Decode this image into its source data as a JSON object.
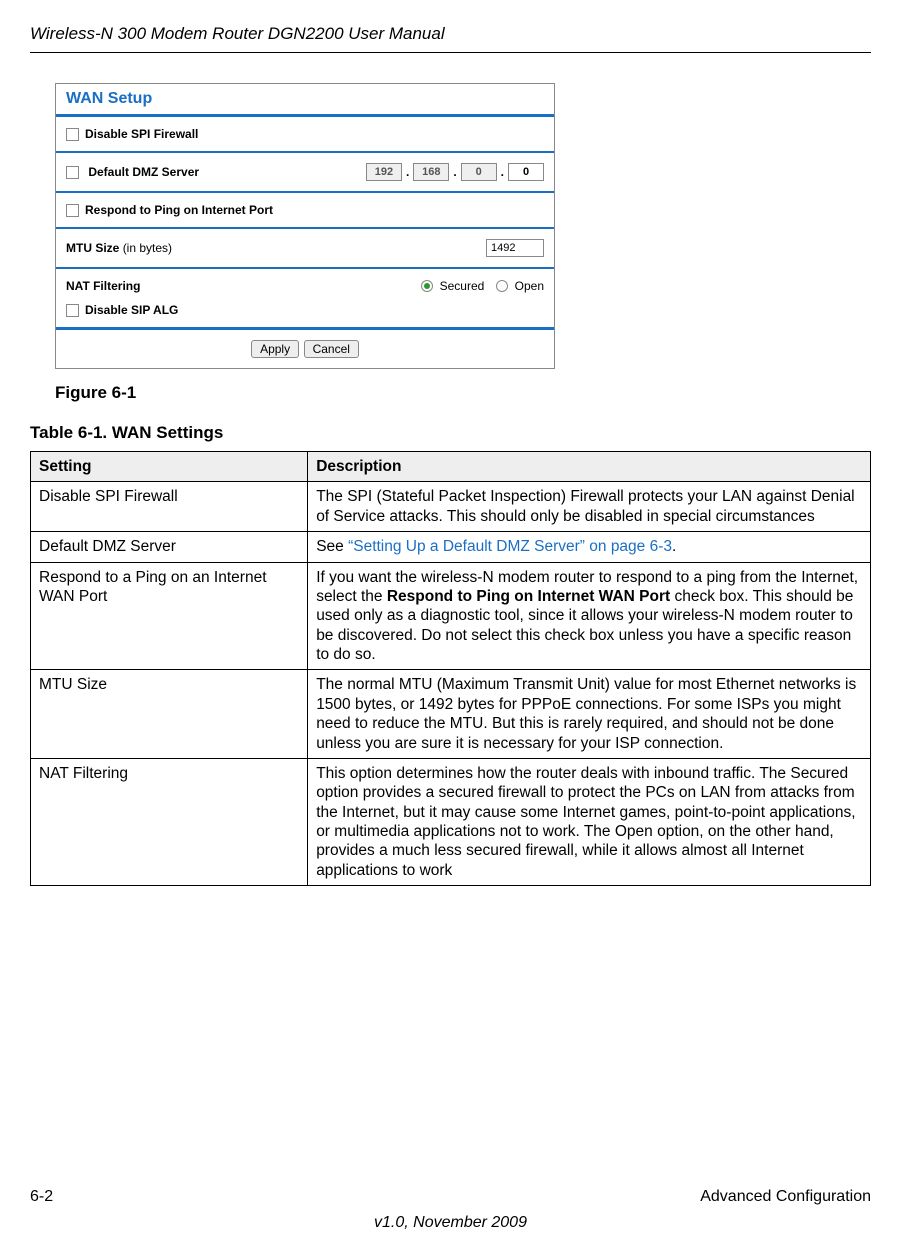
{
  "running_header": "Wireless-N 300 Modem Router DGN2200 User Manual",
  "screenshot": {
    "title": "WAN Setup",
    "row1_label": "Disable SPI Firewall",
    "row2_label": "Default DMZ Server",
    "ip": {
      "o1": "192",
      "o2": "168",
      "o3": "0",
      "o4": "0"
    },
    "row3_label": "Respond to Ping on Internet Port",
    "row4_label": "MTU Size",
    "row4_suffix": "(in bytes)",
    "mtu_value": "1492",
    "row5_label": "NAT Filtering",
    "radio_secured": "Secured",
    "radio_open": "Open",
    "row6_label": "Disable SIP ALG",
    "btn_apply": "Apply",
    "btn_cancel": "Cancel"
  },
  "figure_caption": "Figure 6-1",
  "table_caption": "Table 6-1.  WAN Settings",
  "table": {
    "head": {
      "c1": "Setting",
      "c2": "Description"
    },
    "rows": [
      {
        "setting": "Disable SPI Firewall",
        "desc": "The SPI (Stateful Packet Inspection) Firewall protects your LAN against Denial of Service attacks. This should only be disabled in special circumstances"
      },
      {
        "setting": "Default DMZ Server",
        "desc_pre": "See ",
        "desc_link": "“Setting Up a Default DMZ Server” on page 6-3",
        "desc_post": "."
      },
      {
        "setting": "Respond to a Ping on an Internet WAN Port",
        "desc_pre": "If you want the wireless-N modem router to respond to a ping from the Internet, select the ",
        "desc_bold": "Respond to Ping on Internet WAN Port",
        "desc_post": " check box. This should be used only as a diagnostic tool, since it allows your wireless-N modem router to be discovered. Do not select this check box unless you have a specific reason to do so."
      },
      {
        "setting": "MTU Size",
        "desc": "The normal MTU (Maximum Transmit Unit) value for most Ethernet networks is 1500 bytes, or 1492 bytes for PPPoE connections. For some ISPs you might need to reduce the MTU. But this is rarely required, and should not be done unless you are sure it is necessary for your ISP connection."
      },
      {
        "setting": "NAT Filtering",
        "desc": "This option determines how the router deals with inbound traffic. The Secured option provides a secured firewall to protect the PCs on LAN from attacks from the Internet, but it may cause some Internet games, point-to-point applications, or multimedia applications not to work. The Open option, on the other hand, provides a much less secured firewall, while it allows almost all Internet applications to work"
      }
    ]
  },
  "footer": {
    "page_num": "6-2",
    "section": "Advanced Configuration",
    "version": "v1.0, November 2009"
  }
}
